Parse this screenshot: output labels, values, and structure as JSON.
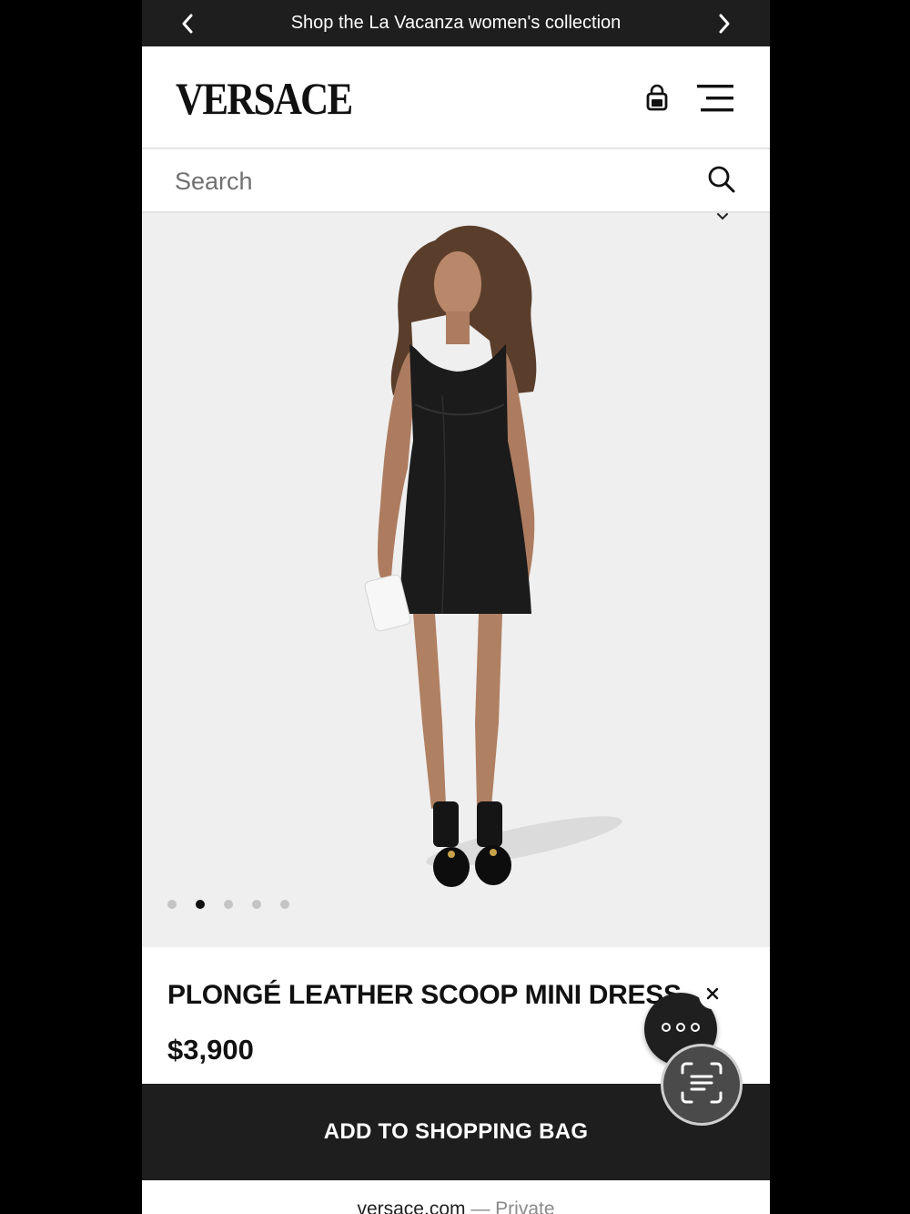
{
  "promo": {
    "text": "Shop the La Vacanza women's collection"
  },
  "header": {
    "brand": "VERSACE"
  },
  "search": {
    "placeholder": "Search"
  },
  "gallery": {
    "image_count": 5,
    "active_index": 1
  },
  "product": {
    "name": "PLONGÉ LEATHER SCOOP MINI DRESS",
    "price": "$3,900"
  },
  "cta": {
    "add_to_bag": "ADD TO SHOPPING BAG"
  },
  "browser": {
    "domain": "versace.com",
    "separator": " — ",
    "mode": "Private"
  },
  "colors": {
    "bar_dark": "#1e1e1e",
    "gallery_bg": "#efefef",
    "dot_active": "#111111",
    "dot_inactive": "#c4c4c4"
  },
  "icons": [
    "chevron-left-icon",
    "chevron-right-icon",
    "shopping-bag-icon",
    "hamburger-menu-icon",
    "search-icon",
    "chevron-down-icon",
    "more-icon",
    "close-icon",
    "scan-text-icon"
  ]
}
